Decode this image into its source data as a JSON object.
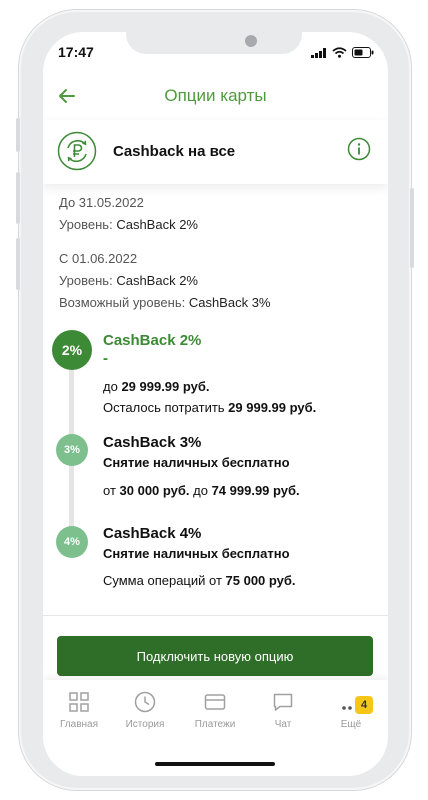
{
  "status": {
    "time": "17:47"
  },
  "header": {
    "title": "Опции карты"
  },
  "option": {
    "title": "Cashback на все"
  },
  "current_period": {
    "date": "До 31.05.2022",
    "level_label": "Уровень:",
    "level_value": "CashBack 2%"
  },
  "next_period": {
    "date": "С 01.06.2022",
    "level_label": "Уровень:",
    "level_value": "CashBack 2%",
    "possible_label": "Возможный уровень:",
    "possible_value": "CashBack 3%"
  },
  "levels": [
    {
      "badge": "2%",
      "title": "CashBack 2%",
      "subtitle": "-",
      "line1_prefix": "до ",
      "line1_value": "29 999.99 руб.",
      "line2_prefix": "Осталось потратить ",
      "line2_value": "29 999.99 руб."
    },
    {
      "badge": "3%",
      "title": "CashBack 3%",
      "subtitle": "Снятие наличных бесплатно",
      "from_prefix": "от ",
      "from_value": "30 000 руб.",
      "to_prefix": " до ",
      "to_value": "74 999.99 руб."
    },
    {
      "badge": "4%",
      "title": "CashBack 4%",
      "subtitle": "Снятие наличных бесплатно",
      "sum_prefix": "Сумма операций от ",
      "sum_value": "75 000 руб."
    }
  ],
  "primary_button": {
    "label": "Подключить новую опцию"
  },
  "tabs": [
    {
      "label": "Главная",
      "icon": "grid-icon"
    },
    {
      "label": "История",
      "icon": "clock-icon"
    },
    {
      "label": "Платежи",
      "icon": "card-icon"
    },
    {
      "label": "Чат",
      "icon": "chat-icon"
    },
    {
      "label": "Ещё",
      "icon": "more-icon",
      "badge": "4"
    }
  ],
  "colors": {
    "accent": "#4f9a3f",
    "button": "#2f6e29",
    "active_level": "#3c8a36",
    "inactive_level": "#7dc08d",
    "badge": "#f5c518"
  }
}
